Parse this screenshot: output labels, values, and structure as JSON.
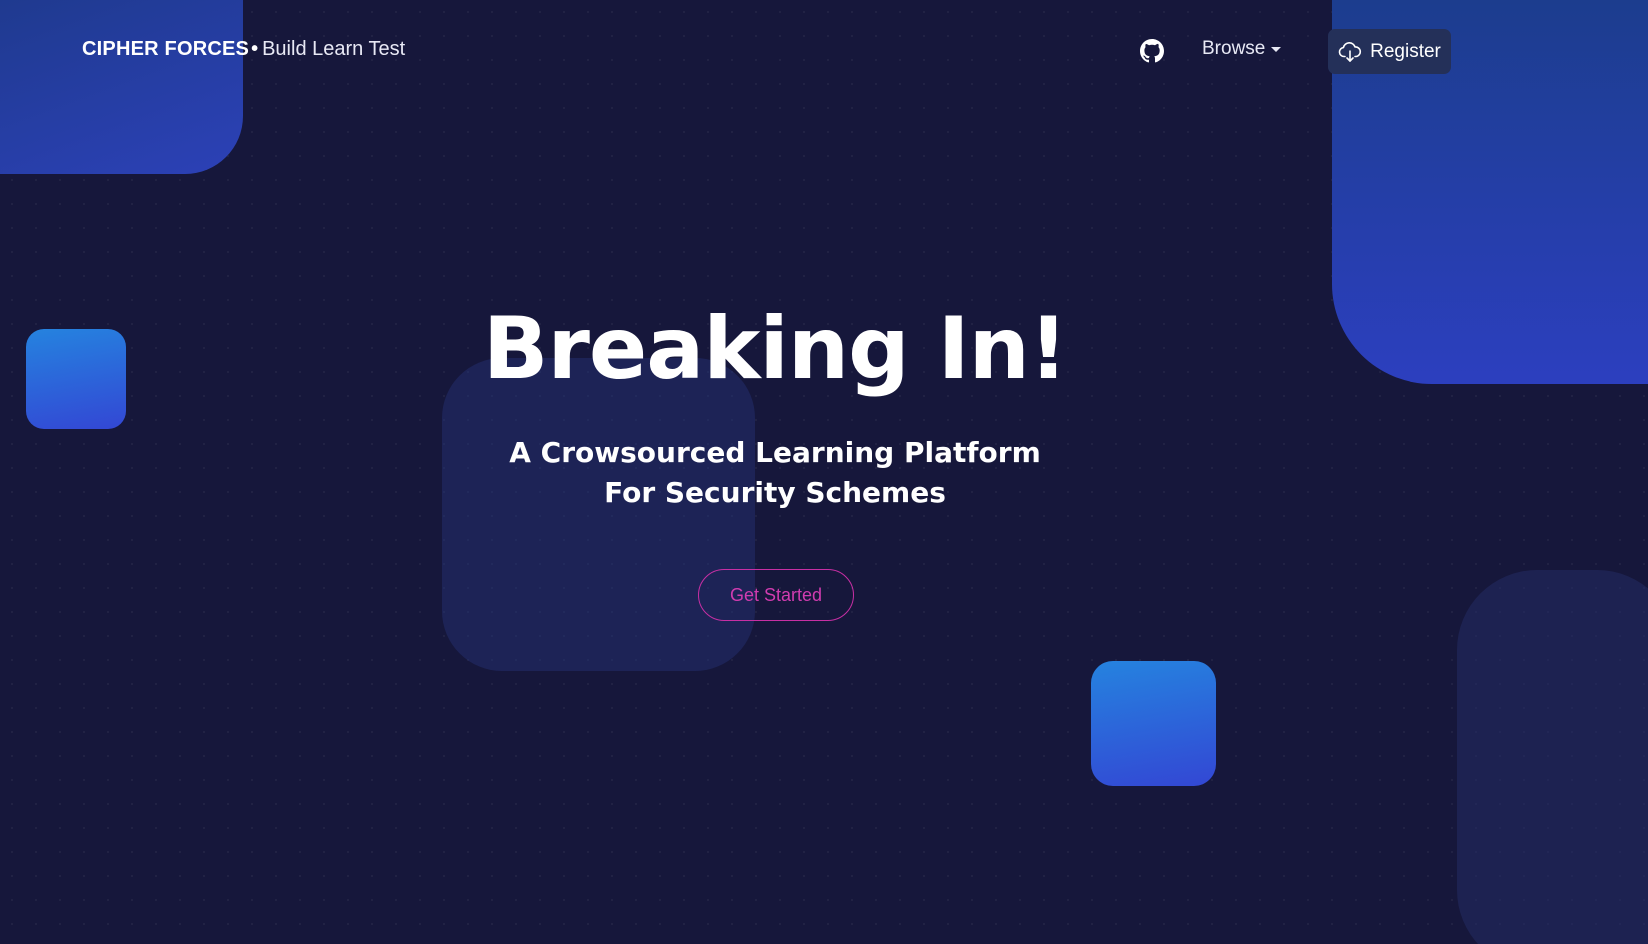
{
  "navbar": {
    "brand_name": "CIPHER FORCES",
    "brand_separator": "•",
    "brand_tagline": "Build Learn Test",
    "github_icon": "github-icon",
    "browse_label": "Browse",
    "register_label": "Register",
    "register_icon": "cloud-download-icon"
  },
  "hero": {
    "title": "Breaking In!",
    "subtitle": "A Crowsourced Learning Platform For Security Schemes",
    "cta_label": "Get Started"
  },
  "colors": {
    "background": "#16173b",
    "accent_blue": "#2c41b7",
    "square_blue_top": "#2583df",
    "square_blue_bottom": "#3347d4",
    "cta_magenta": "#d13cb0",
    "register_bg": "#243059"
  }
}
